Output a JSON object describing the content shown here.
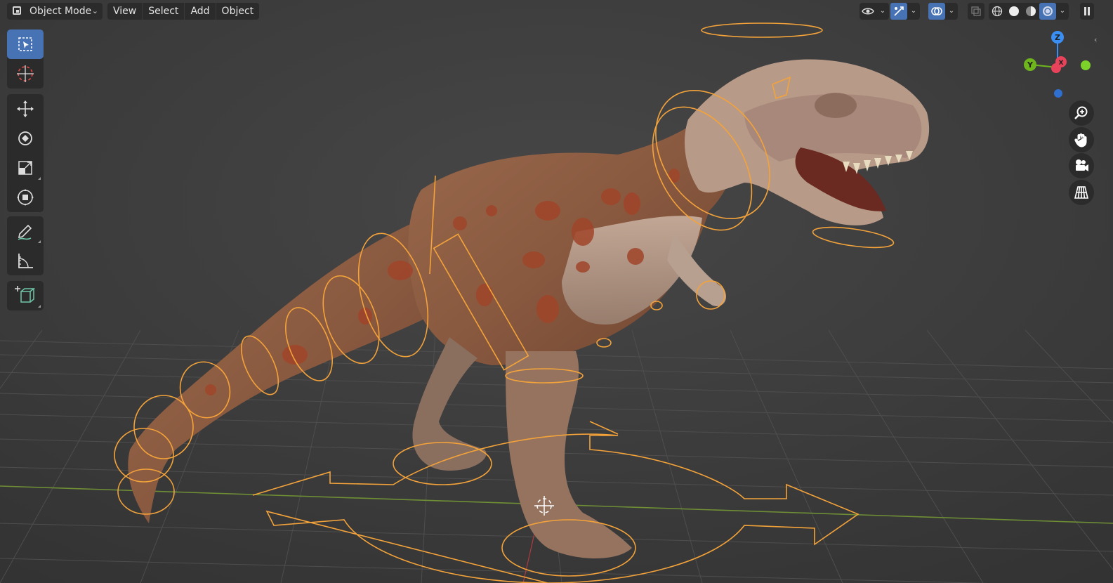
{
  "header": {
    "mode_label": "Object Mode",
    "menus": [
      "View",
      "Select",
      "Add",
      "Object"
    ],
    "right_icons": [
      "visibility-icon",
      "gizmo-icon",
      "overlay-icon",
      "xray-icon",
      "wireframe-shading-icon",
      "solid-shading-icon",
      "material-shading-icon",
      "rendered-shading-icon"
    ],
    "accent_color": "#4772b3"
  },
  "toolbar": {
    "tools": [
      "select-box-tool",
      "cursor-tool",
      "move-tool",
      "rotate-tool",
      "scale-tool",
      "transform-tool",
      "annotate-tool",
      "measure-tool",
      "add-cube-tool"
    ]
  },
  "navigation_gizmo": {
    "axes": {
      "z": "Z",
      "y": "Y",
      "x": "X"
    },
    "colors": {
      "x": "#e8435a",
      "y": "#6fb51e",
      "z": "#3a8ff5"
    }
  },
  "viewport": {
    "grid_color": "#4a4a4a",
    "x_axis_color": "#7a9a3a",
    "rig_color": "#f4a33a",
    "model": "t-rex"
  }
}
